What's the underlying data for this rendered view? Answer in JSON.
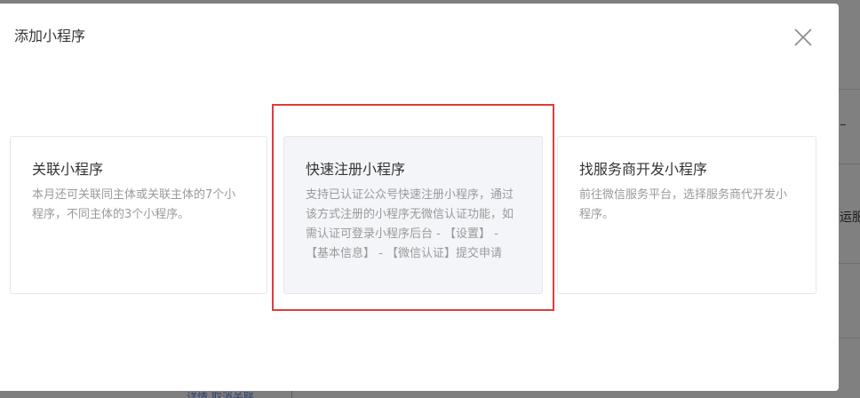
{
  "dialog": {
    "title": "添加小程序",
    "close_icon": "close-icon"
  },
  "cards": [
    {
      "title": "关联小程序",
      "description": "本月还可关联同主体或关联主体的7个小程序，不同主体的3个小程序。"
    },
    {
      "title": "快速注册小程序",
      "description": "支持已认证公众号快速注册小程序，通过该方式注册的小程序无微信认证功能，如需认证可登录小程序后台 - 【设置】 - 【基本信息】 - 【微信认证】提交申请"
    },
    {
      "title": "找服务商开发小程序",
      "description": "前往微信服务平台，选择服务商代开发小程序。"
    }
  ],
  "background": {
    "right_text": "运服务",
    "bottom_text": "详情 取消关联"
  },
  "colors": {
    "highlight": "#e03c3c",
    "active_card_bg": "#f4f5f9"
  }
}
